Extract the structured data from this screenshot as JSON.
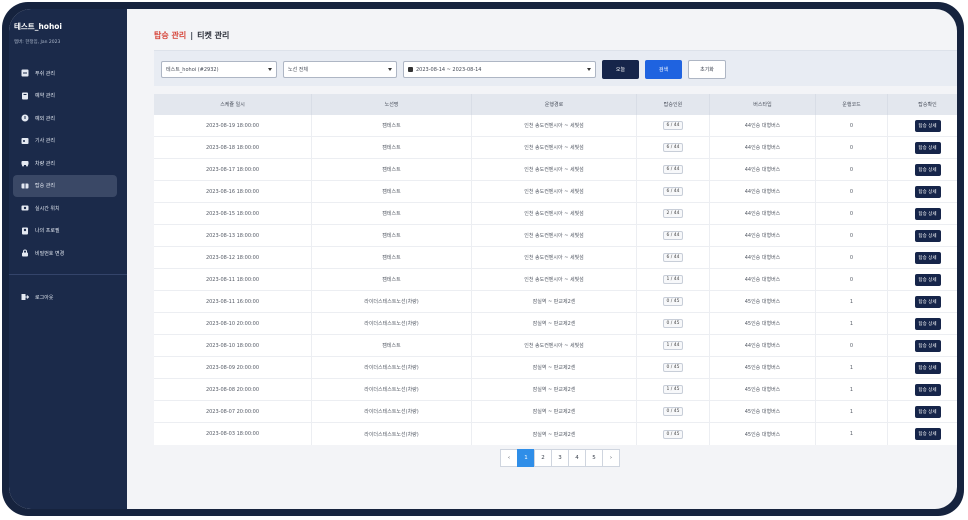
{
  "brand": {
    "title": "테스트_hohoi",
    "subtitle": "멤버: 한정임, Jan 2023"
  },
  "sidebar": {
    "items": [
      {
        "label": "푸쉬 관리",
        "icon": "push-icon"
      },
      {
        "label": "예약 관리",
        "icon": "reservation-icon"
      },
      {
        "label": "예외 관리",
        "icon": "exception-icon"
      },
      {
        "label": "기사 관리",
        "icon": "driver-icon"
      },
      {
        "label": "차량 관리",
        "icon": "vehicle-icon"
      },
      {
        "label": "탑승 관리",
        "icon": "boarding-icon",
        "active": true
      },
      {
        "label": "실시간 위치",
        "icon": "location-icon"
      },
      {
        "label": "나의 프로필",
        "icon": "profile-icon"
      },
      {
        "label": "비밀번호 변경",
        "icon": "lock-icon"
      }
    ],
    "logout": {
      "label": "로그아웃",
      "icon": "logout-icon"
    }
  },
  "breadcrumb": {
    "section": "탑승 관리",
    "separator": "|",
    "current": "티켓 관리"
  },
  "filters": {
    "company": "테스트_hohoi (#2932)",
    "route": "노선 전체",
    "date_range": "2023-08-14 ~ 2023-08-14",
    "btn_search_alt": "오늘",
    "btn_search": "검색",
    "btn_reset": "초기화"
  },
  "table": {
    "headers": [
      "스케쥴 일시",
      "노선명",
      "운행경로",
      "탑승인원",
      "버스타입",
      "운행코드",
      "탑승확인"
    ],
    "rows": [
      [
        "2023-08-19 18:00:00",
        "캠테스트",
        "인천 송도컨벤시아 ~ 세빛섬",
        "6 / 44",
        "44인승 대형버스",
        "0",
        "탑승 상세"
      ],
      [
        "2023-08-18 18:00:00",
        "캠테스트",
        "인천 송도컨벤시아 ~ 세빛섬",
        "6 / 44",
        "44인승 대형버스",
        "0",
        "탑승 상세"
      ],
      [
        "2023-08-17 18:00:00",
        "캠테스트",
        "인천 송도컨벤시아 ~ 세빛섬",
        "6 / 44",
        "44인승 대형버스",
        "0",
        "탑승 상세"
      ],
      [
        "2023-08-16 18:00:00",
        "캠테스트",
        "인천 송도컨벤시아 ~ 세빛섬",
        "6 / 44",
        "44인승 대형버스",
        "0",
        "탑승 상세"
      ],
      [
        "2023-08-15 18:00:00",
        "캠테스트",
        "인천 송도컨벤시아 ~ 세빛섬",
        "2 / 44",
        "44인승 대형버스",
        "0",
        "탑승 상세"
      ],
      [
        "2023-08-13 18:00:00",
        "캠테스트",
        "인천 송도컨벤시아 ~ 세빛섬",
        "6 / 44",
        "44인승 대형버스",
        "0",
        "탑승 상세"
      ],
      [
        "2023-08-12 18:00:00",
        "캠테스트",
        "인천 송도컨벤시아 ~ 세빛섬",
        "6 / 44",
        "44인승 대형버스",
        "0",
        "탑승 상세"
      ],
      [
        "2023-08-11 18:00:00",
        "캠테스트",
        "인천 송도컨벤시아 ~ 세빛섬",
        "1 / 44",
        "44인승 대형버스",
        "0",
        "탑승 상세"
      ],
      [
        "2023-08-11 16:00:00",
        "라이더스테스트노선(차량)",
        "잠실역 ~ 판교제2센",
        "0 / 45",
        "45인승 대형버스",
        "1",
        "탑승 상세"
      ],
      [
        "2023-08-10 20:00:00",
        "라이더스테스트노선(차량)",
        "잠실역 ~ 판교제2센",
        "0 / 45",
        "45인승 대형버스",
        "1",
        "탑승 상세"
      ],
      [
        "2023-08-10 18:00:00",
        "캠테스트",
        "인천 송도컨벤시아 ~ 세빛섬",
        "1 / 44",
        "44인승 대형버스",
        "0",
        "탑승 상세"
      ],
      [
        "2023-08-09 20:00:00",
        "라이더스테스트노선(차량)",
        "잠실역 ~ 판교제2센",
        "0 / 45",
        "45인승 대형버스",
        "1",
        "탑승 상세"
      ],
      [
        "2023-08-08 20:00:00",
        "라이더스테스트노선(차량)",
        "잠실역 ~ 판교제2센",
        "1 / 45",
        "45인승 대형버스",
        "1",
        "탑승 상세"
      ],
      [
        "2023-08-07 20:00:00",
        "라이더스테스트노선(차량)",
        "잠실역 ~ 판교제2센",
        "0 / 45",
        "45인승 대형버스",
        "1",
        "탑승 상세"
      ],
      [
        "2023-08-03 18:00:00",
        "라이더스테스트노선(차량)",
        "잠실역 ~ 판교제2센",
        "0 / 45",
        "45인승 대형버스",
        "1",
        "탑승 상세"
      ]
    ]
  },
  "pagination": {
    "prev": "‹",
    "pages": [
      "1",
      "2",
      "3",
      "4",
      "5"
    ],
    "active": "1",
    "next": "›"
  },
  "colors": {
    "sidebar": "#1b2a4a",
    "accent": "#d6453a",
    "primary_button": "#1f63e0",
    "dark_button": "#16254a"
  }
}
